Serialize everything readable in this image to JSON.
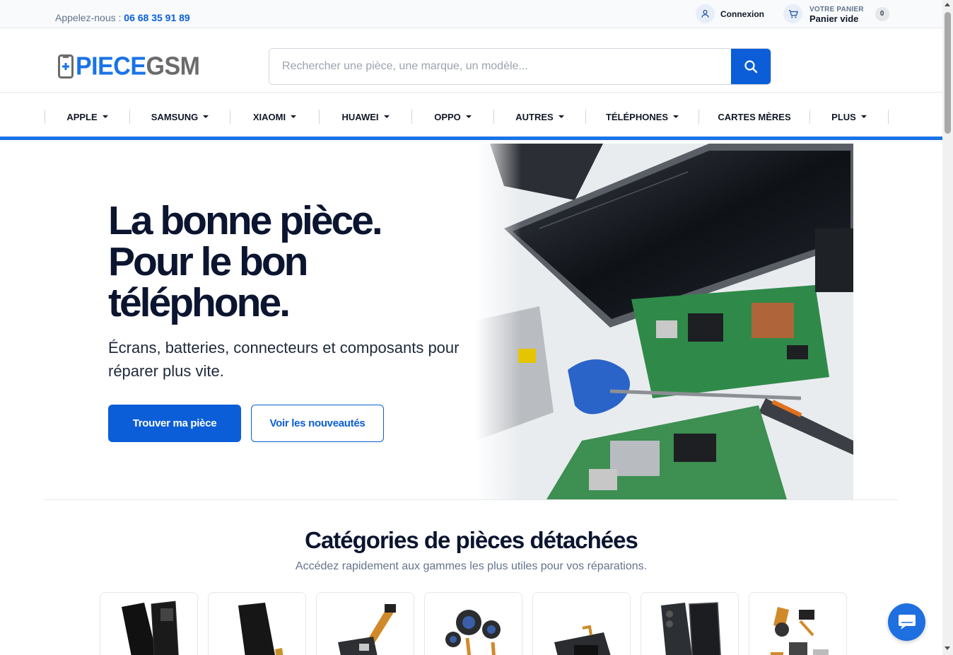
{
  "topbar": {
    "phone_prefix": "Appelez-nous :",
    "phone_number": "06 68 35 91 89",
    "login_label": "Connexion",
    "cart_small": "VOTRE PANIER",
    "cart_big": "Panier vide",
    "cart_count": "0"
  },
  "header": {
    "logo_part1": "PIECE",
    "logo_part2": "GSM",
    "search_placeholder": "Rechercher une pièce, une marque, un modèle..."
  },
  "nav": {
    "items": [
      {
        "label": "APPLE",
        "dropdown": true
      },
      {
        "label": "SAMSUNG",
        "dropdown": true
      },
      {
        "label": "XIAOMI",
        "dropdown": true
      },
      {
        "label": "HUAWEI",
        "dropdown": true
      },
      {
        "label": "OPPO",
        "dropdown": true
      },
      {
        "label": "AUTRES",
        "dropdown": true
      },
      {
        "label": "TÉLÉPHONES",
        "dropdown": true
      },
      {
        "label": "CARTES MÈRES",
        "dropdown": false
      },
      {
        "label": "PLUS",
        "dropdown": true
      }
    ]
  },
  "hero": {
    "title_line1": "La bonne pièce.",
    "title_line2": "Pour le bon",
    "title_line3": "téléphone.",
    "subtitle": "Écrans, batteries, connecteurs et composants pour réparer plus vite.",
    "primary_button": "Trouver ma pièce",
    "secondary_button": "Voir les nouveautés"
  },
  "categories": {
    "title": "Catégories de pièces détachées",
    "subtitle": "Accédez rapidement aux gammes les plus utiles pour vos réparations.",
    "items": [
      {
        "icon": "screen-part-icon"
      },
      {
        "icon": "battery-part-icon"
      },
      {
        "icon": "flex-connector-icon"
      },
      {
        "icon": "camera-module-icon"
      },
      {
        "icon": "speaker-part-icon"
      },
      {
        "icon": "back-cover-icon"
      },
      {
        "icon": "small-components-icon"
      }
    ]
  },
  "colors": {
    "primary": "#0b5ed7",
    "accent": "#1a73e8",
    "heading": "#0b1530"
  }
}
